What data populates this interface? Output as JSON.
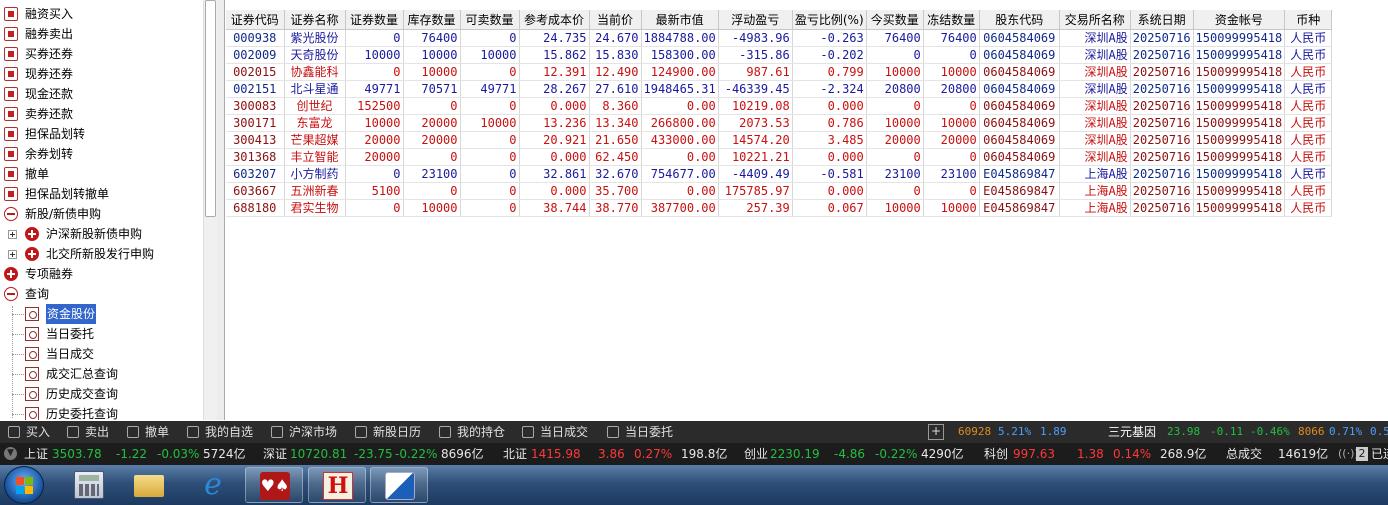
{
  "sidebar": {
    "items": [
      {
        "label": "融资买入",
        "icon": "box-icon",
        "indent": 0
      },
      {
        "label": "融券卖出",
        "icon": "box-icon",
        "indent": 0
      },
      {
        "label": "买券还券",
        "icon": "box-icon",
        "indent": 0
      },
      {
        "label": "现券还券",
        "icon": "box-icon",
        "indent": 0
      },
      {
        "label": "现金还款",
        "icon": "box-icon",
        "indent": 0
      },
      {
        "label": "卖券还款",
        "icon": "box-icon",
        "indent": 0
      },
      {
        "label": "担保品划转",
        "icon": "box-icon",
        "indent": 0
      },
      {
        "label": "余券划转",
        "icon": "box-icon",
        "indent": 0
      },
      {
        "label": "撤单",
        "icon": "undo-icon",
        "indent": 0
      },
      {
        "label": "担保品划转撤单",
        "icon": "undo-icon",
        "indent": 0
      },
      {
        "label": "新股/新债申购",
        "icon": "minus-circle-icon",
        "indent": 0
      },
      {
        "label": "沪深新股新债申购",
        "icon": "plus-circle-icon",
        "indent": 1
      },
      {
        "label": "北交所新股发行申购",
        "icon": "plus-circle-icon",
        "indent": 1
      },
      {
        "label": "专项融券",
        "icon": "plus-circle-icon",
        "indent": 0
      },
      {
        "label": "查询",
        "icon": "minus-circle-icon",
        "indent": 0
      },
      {
        "label": "资金股份",
        "icon": "doc-icon",
        "indent": 2,
        "selected": true
      },
      {
        "label": "当日委托",
        "icon": "doc-icon",
        "indent": 2
      },
      {
        "label": "当日成交",
        "icon": "doc-icon",
        "indent": 2
      },
      {
        "label": "成交汇总查询",
        "icon": "doc-icon",
        "indent": 2
      },
      {
        "label": "历史成交查询",
        "icon": "doc-icon",
        "indent": 2
      },
      {
        "label": "历史委托查询",
        "icon": "doc-icon",
        "indent": 2
      }
    ]
  },
  "table": {
    "columns": [
      "证券代码",
      "证券名称",
      "证券数量",
      "库存数量",
      "可卖数量",
      "参考成本价",
      "当前价",
      "最新市值",
      "浮动盈亏",
      "盈亏比例(%)",
      "今买数量",
      "冻结数量",
      "股东代码",
      "交易所名称",
      "系统日期",
      "资金帐号",
      "币种"
    ],
    "rows": [
      {
        "tone": "blue",
        "cells": [
          "000938",
          "紫光股份",
          "0",
          "76400",
          "0",
          "24.735",
          "24.670",
          "1884788.00",
          "-4983.96",
          "-0.263",
          "76400",
          "76400",
          "0604584069",
          "深圳A股",
          "20250716",
          "150099995418",
          "人民币"
        ]
      },
      {
        "tone": "blue",
        "cells": [
          "002009",
          "天奇股份",
          "10000",
          "10000",
          "10000",
          "15.862",
          "15.830",
          "158300.00",
          "-315.86",
          "-0.202",
          "0",
          "0",
          "0604584069",
          "深圳A股",
          "20250716",
          "150099995418",
          "人民币"
        ]
      },
      {
        "tone": "red",
        "cells": [
          "002015",
          "协鑫能科",
          "0",
          "10000",
          "0",
          "12.391",
          "12.490",
          "124900.00",
          "987.61",
          "0.799",
          "10000",
          "10000",
          "0604584069",
          "深圳A股",
          "20250716",
          "150099995418",
          "人民币"
        ]
      },
      {
        "tone": "blue",
        "cells": [
          "002151",
          "北斗星通",
          "49771",
          "70571",
          "49771",
          "28.267",
          "27.610",
          "1948465.31",
          "-46339.45",
          "-2.324",
          "20800",
          "20800",
          "0604584069",
          "深圳A股",
          "20250716",
          "150099995418",
          "人民币"
        ]
      },
      {
        "tone": "red",
        "cells": [
          "300083",
          "创世纪",
          "152500",
          "0",
          "0",
          "0.000",
          "8.360",
          "0.00",
          "10219.08",
          "0.000",
          "0",
          "0",
          "0604584069",
          "深圳A股",
          "20250716",
          "150099995418",
          "人民币"
        ]
      },
      {
        "tone": "red",
        "cells": [
          "300171",
          "东富龙",
          "10000",
          "20000",
          "10000",
          "13.236",
          "13.340",
          "266800.00",
          "2073.53",
          "0.786",
          "10000",
          "10000",
          "0604584069",
          "深圳A股",
          "20250716",
          "150099995418",
          "人民币"
        ]
      },
      {
        "tone": "red",
        "cells": [
          "300413",
          "芒果超媒",
          "20000",
          "20000",
          "0",
          "20.921",
          "21.650",
          "433000.00",
          "14574.20",
          "3.485",
          "20000",
          "20000",
          "0604584069",
          "深圳A股",
          "20250716",
          "150099995418",
          "人民币"
        ]
      },
      {
        "tone": "red",
        "cells": [
          "301368",
          "丰立智能",
          "20000",
          "0",
          "0",
          "0.000",
          "62.450",
          "0.00",
          "10221.21",
          "0.000",
          "0",
          "0",
          "0604584069",
          "深圳A股",
          "20250716",
          "150099995418",
          "人民币"
        ]
      },
      {
        "tone": "blue",
        "cells": [
          "603207",
          "小方制药",
          "0",
          "23100",
          "0",
          "32.861",
          "32.670",
          "754677.00",
          "-4409.49",
          "-0.581",
          "23100",
          "23100",
          "E045869847",
          "上海A股",
          "20250716",
          "150099995418",
          "人民币"
        ]
      },
      {
        "tone": "red",
        "cells": [
          "603667",
          "五洲新春",
          "5100",
          "0",
          "0",
          "0.000",
          "35.700",
          "0.00",
          "175785.97",
          "0.000",
          "0",
          "0",
          "E045869847",
          "上海A股",
          "20250716",
          "150099995418",
          "人民币"
        ]
      },
      {
        "tone": "red",
        "cells": [
          "688180",
          "君实生物",
          "0",
          "10000",
          "0",
          "38.744",
          "38.770",
          "387700.00",
          "257.39",
          "0.067",
          "10000",
          "10000",
          "E045869847",
          "上海A股",
          "20250716",
          "150099995418",
          "人民币"
        ]
      }
    ]
  },
  "toolbar": {
    "buttons": [
      "买入",
      "卖出",
      "撤单",
      "我的自选",
      "沪深市场",
      "新股日历",
      "我的持仓",
      "当日成交",
      "当日委托"
    ],
    "plus": "+",
    "ticker": {
      "left_num": "60928",
      "left_pct": "5.21%",
      "left_val": "1.89",
      "name": "三元基因",
      "price": "23.98",
      "chg": "-0.11",
      "pct": "-0.46%",
      "vol": "8066",
      "pct2": "0.71%",
      "tail": "0.5"
    }
  },
  "market": {
    "sh": {
      "label": "上证",
      "value": "3503.78",
      "chg": "-1.22",
      "pct": "-0.03%",
      "amount": "5724亿"
    },
    "sz": {
      "label": "深证",
      "value": "10720.81",
      "chg": "-23.75",
      "pct": "-0.22%",
      "amount": "8696亿"
    },
    "bz": {
      "label": "北证",
      "value": "1415.98",
      "chg": "3.86",
      "pct": "0.27%",
      "amount": "198.8亿"
    },
    "cy": {
      "label": "创业",
      "value": "2230.19",
      "chg": "-4.86",
      "pct": "-0.22%",
      "amount": "4290亿"
    },
    "kc": {
      "label": "科创",
      "value": "997.63",
      "chg": "1.38",
      "pct": "0.14%",
      "amount": "268.9亿"
    },
    "total": {
      "label": "总成交",
      "amount": "14619亿"
    },
    "status_num": "2",
    "status_text": "已连"
  },
  "colors": {
    "blue_row": "#1a1a9e",
    "red_row": "#c81010",
    "down": "#22c040",
    "up": "#ff3838"
  }
}
